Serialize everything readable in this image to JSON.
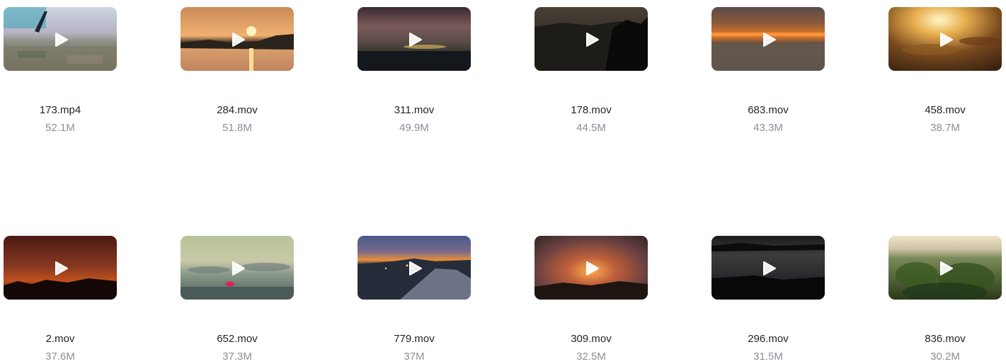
{
  "videos": [
    {
      "name": "173.mp4",
      "size": "52.1M"
    },
    {
      "name": "284.mov",
      "size": "51.8M"
    },
    {
      "name": "311.mov",
      "size": "49.9M"
    },
    {
      "name": "178.mov",
      "size": "44.5M"
    },
    {
      "name": "683.mov",
      "size": "43.3M"
    },
    {
      "name": "458.mov",
      "size": "38.7M"
    },
    {
      "name": "2.mov",
      "size": "37.6M"
    },
    {
      "name": "652.mov",
      "size": "37.3M"
    },
    {
      "name": "779.mov",
      "size": "37M"
    },
    {
      "name": "309.mov",
      "size": "32.5M"
    },
    {
      "name": "296.mov",
      "size": "31.5M"
    },
    {
      "name": "836.mov",
      "size": "30.2M"
    }
  ],
  "icons": {
    "thumbnail_overlay": "play-icon"
  }
}
